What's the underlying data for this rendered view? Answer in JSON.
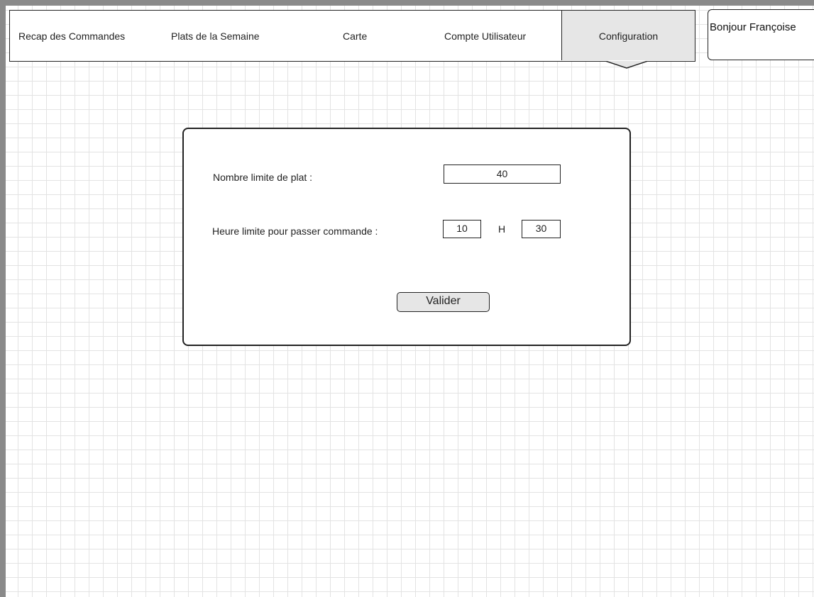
{
  "nav": {
    "items": [
      {
        "label": "Recap des Commandes"
      },
      {
        "label": "Plats de la Semaine"
      },
      {
        "label": "Carte"
      },
      {
        "label": "Compte Utilisateur"
      },
      {
        "label": "Configuration",
        "active": true
      }
    ]
  },
  "user": {
    "greeting": "Bonjour Françoise"
  },
  "config": {
    "dish_limit_label": "Nombre limite de plat :",
    "dish_limit_value": "40",
    "order_deadline_label": "Heure limite pour passer commande :",
    "hour_value": "10",
    "hour_separator": "H",
    "minute_value": "30",
    "submit_label": "Valider"
  }
}
